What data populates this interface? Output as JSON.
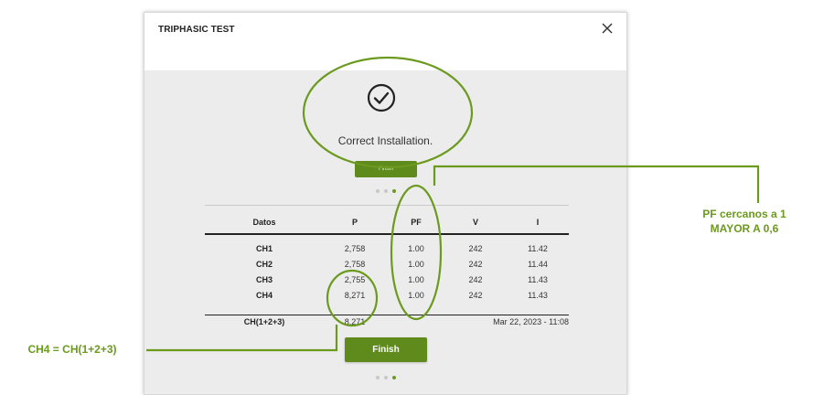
{
  "dialog": {
    "title": "TRIPHASIC TEST",
    "status": "Correct Installation.",
    "mini_button": "Finish",
    "finish_button": "Finish"
  },
  "table": {
    "headers": [
      "Datos",
      "P",
      "PF",
      "V",
      "I"
    ],
    "rows": [
      {
        "label": "CH1",
        "p": "2,758",
        "pf": "1.00",
        "v": "242",
        "i": "11.42"
      },
      {
        "label": "CH2",
        "p": "2,758",
        "pf": "1.00",
        "v": "242",
        "i": "11.44"
      },
      {
        "label": "CH3",
        "p": "2,755",
        "pf": "1.00",
        "v": "242",
        "i": "11.43"
      },
      {
        "label": "CH4",
        "p": "8,271",
        "pf": "1.00",
        "v": "242",
        "i": "11.43"
      }
    ],
    "footer": {
      "label": "CH(1+2+3)",
      "p": "8,271",
      "datetime": "Mar 22, 2023 - 11:08"
    }
  },
  "annotations": {
    "pf_line1": "PF cercanos a 1",
    "pf_line2": "MAYOR A 0,6",
    "ch4_note": "CH4 = CH(1+2+3)"
  },
  "colors": {
    "accent": "#5f8a1c",
    "annotation": "#6b9a1f",
    "body_bg": "#ececec"
  },
  "icons": {
    "close": "close-icon",
    "check": "check-circle-icon"
  }
}
